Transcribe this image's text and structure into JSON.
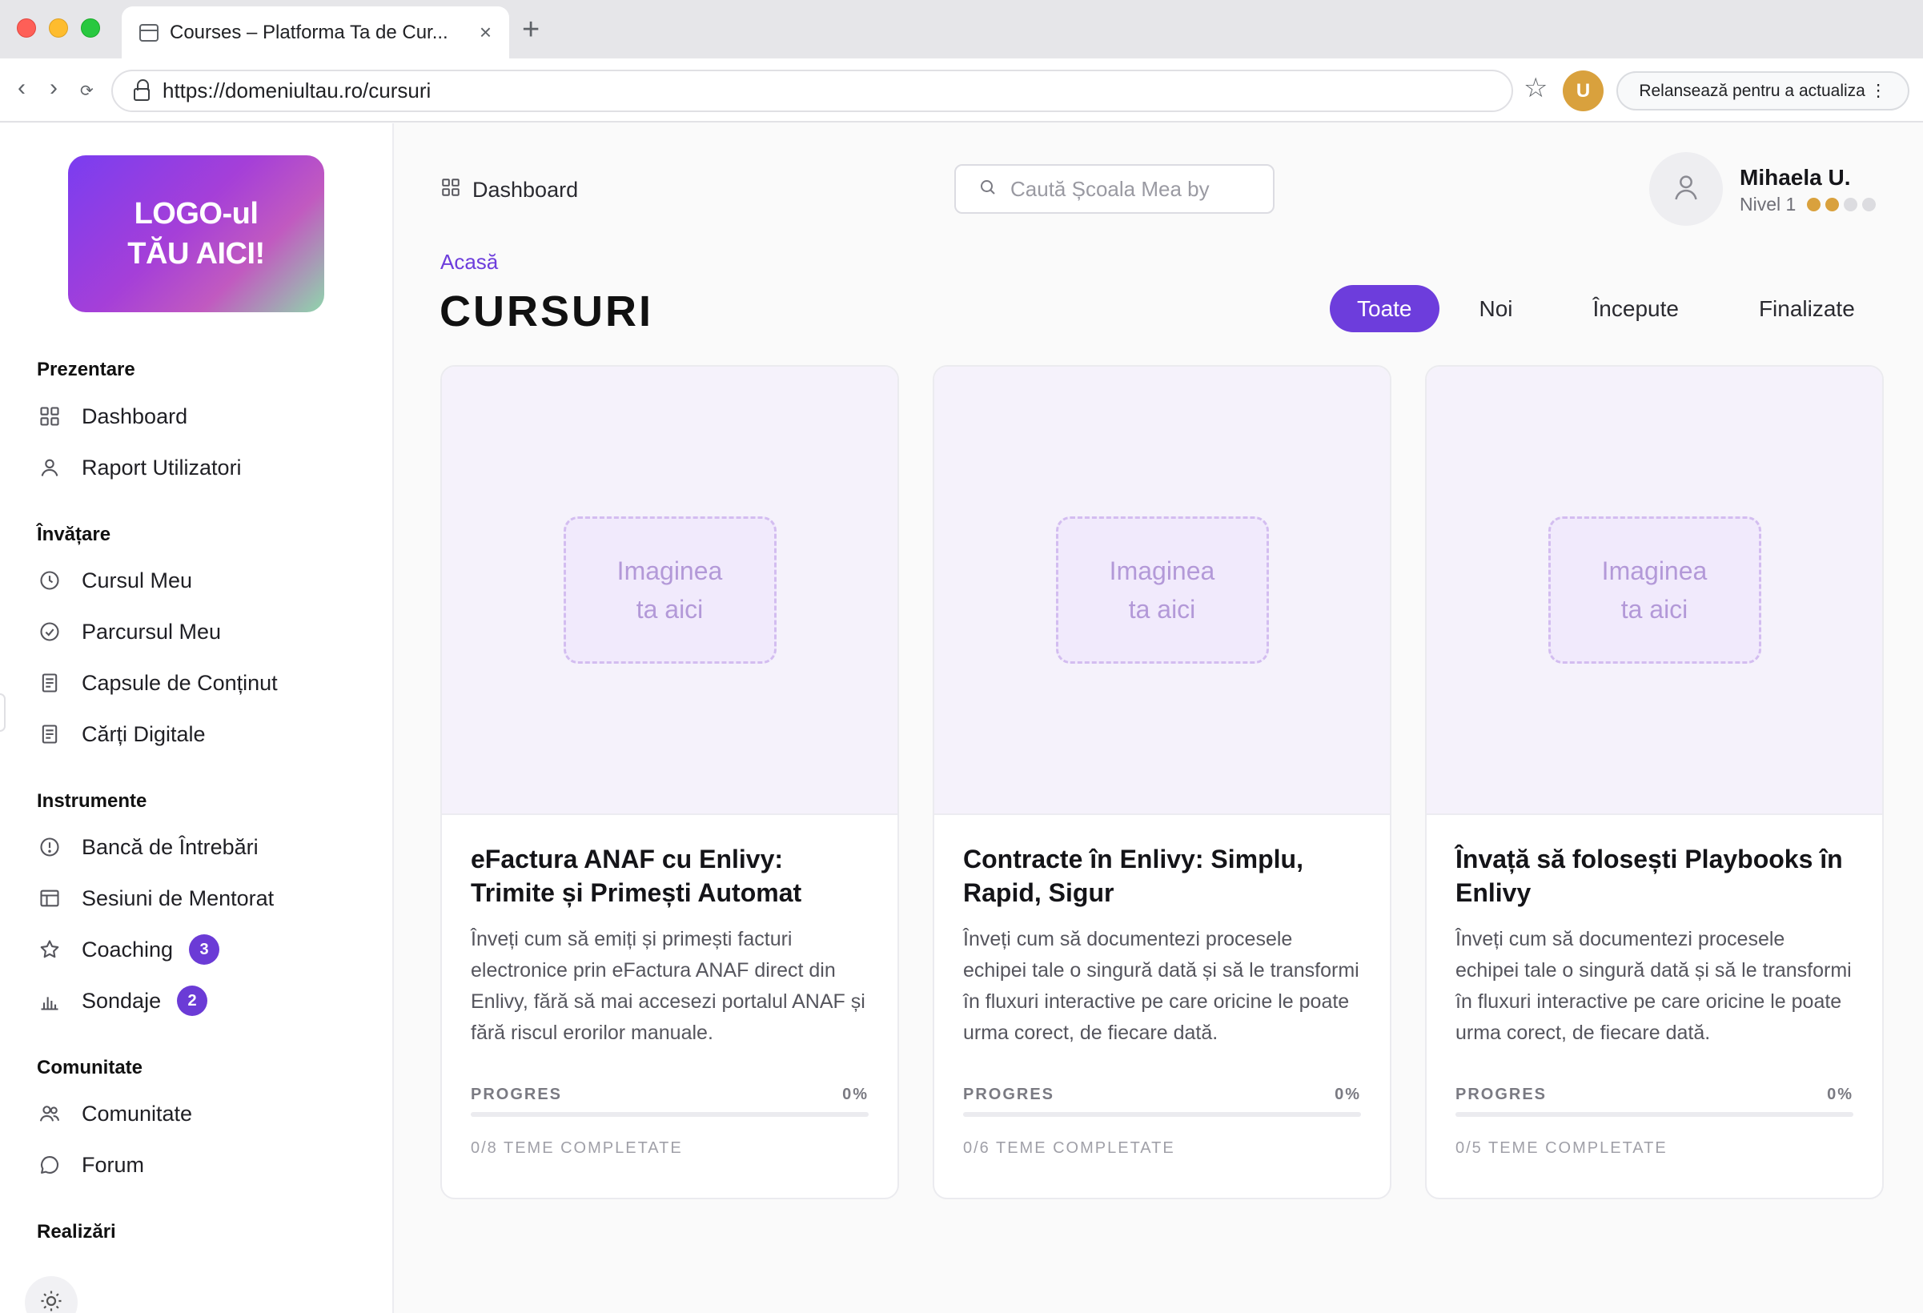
{
  "browser": {
    "tab_title": "Courses – Platforma Ta de Cur...",
    "tab_close": "×",
    "new_tab": "+",
    "url": "https://domeniultau.ro/cursuri",
    "back": "‹",
    "forward": "›",
    "reload": "⟳",
    "bookmark": "☆",
    "profile_initial": "U",
    "relaunch_label": "Relansează pentru a actualiza ⋮"
  },
  "sidebar": {
    "logo_text": "LOGO-ul\nTĂU AICI!",
    "sections": [
      {
        "title": "Prezentare",
        "items": [
          {
            "label": "Dashboard",
            "icon": "grid-icon"
          },
          {
            "label": "Raport Utilizatori",
            "icon": "user-icon"
          }
        ]
      },
      {
        "title": "Învățare",
        "items": [
          {
            "label": "Cursul Meu",
            "icon": "clock-icon"
          },
          {
            "label": "Parcursul Meu",
            "icon": "check-circle-icon"
          },
          {
            "label": "Capsule de Conținut",
            "icon": "document-icon"
          },
          {
            "label": "Cărți Digitale",
            "icon": "book-icon"
          }
        ]
      },
      {
        "title": "Instrumente",
        "items": [
          {
            "label": "Bancă de Întrebări",
            "icon": "alert-circle-icon"
          },
          {
            "label": "Sesiuni de Mentorat",
            "icon": "table-icon"
          },
          {
            "label": "Coaching",
            "icon": "star-icon",
            "badge": "3"
          },
          {
            "label": "Sondaje",
            "icon": "bar-chart-icon",
            "badge": "2"
          }
        ]
      },
      {
        "title": "Comunitate",
        "items": [
          {
            "label": "Comunitate",
            "icon": "users-icon"
          },
          {
            "label": "Forum",
            "icon": "chat-icon"
          }
        ]
      },
      {
        "title": "Realizări",
        "items": []
      }
    ]
  },
  "header": {
    "breadcrumb_top": "Dashboard",
    "search_placeholder": "Caută Școala Mea by",
    "user_name": "Mihaela U.",
    "user_level": "Nivel 1",
    "level_dots_filled": 2,
    "level_dots_total": 4
  },
  "page": {
    "breadcrumb": "Acasă",
    "title": "CURSURI",
    "filters": [
      {
        "label": "Toate",
        "active": true
      },
      {
        "label": "Noi",
        "active": false
      },
      {
        "label": "Începute",
        "active": false
      },
      {
        "label": "Finalizate",
        "active": false
      }
    ]
  },
  "courses": [
    {
      "image_placeholder": "Imaginea\nta aici",
      "title": "eFactura ANAF cu Enlivy: Trimite și Primești Automat",
      "description": "Înveți cum să emiți și primești facturi electronice prin eFactura ANAF direct din Enlivy, fără să mai accesezi portalul ANAF și fără riscul erorilor manuale.",
      "progress_label": "PROGRES",
      "progress_percent": 0,
      "progress_text": "0%",
      "topics_completed": "0/8 TEME COMPLETATE"
    },
    {
      "image_placeholder": "Imaginea\nta aici",
      "title": "Contracte în Enlivy: Simplu, Rapid, Sigur",
      "description": "Înveți cum să documentezi procesele echipei tale o singură dată și să le transformi în fluxuri interactive pe care oricine le poate urma corect, de fiecare dată.",
      "progress_label": "PROGRES",
      "progress_percent": 0,
      "progress_text": "0%",
      "topics_completed": "0/6 TEME COMPLETATE"
    },
    {
      "image_placeholder": "Imaginea\nta aici",
      "title": "Învață să folosești Playbooks în Enlivy",
      "description": "Înveți cum să documentezi procesele echipei tale o singură dată și să le transformi în fluxuri interactive pe care oricine le poate urma corect, de fiecare dată.",
      "progress_label": "PROGRES",
      "progress_percent": 0,
      "progress_text": "0%",
      "topics_completed": "0/5 TEME COMPLETATE"
    }
  ],
  "colors": {
    "accent": "#6d3ddc",
    "level_dot_on": "#d9a13d",
    "level_dot_off": "#dcdce0"
  }
}
